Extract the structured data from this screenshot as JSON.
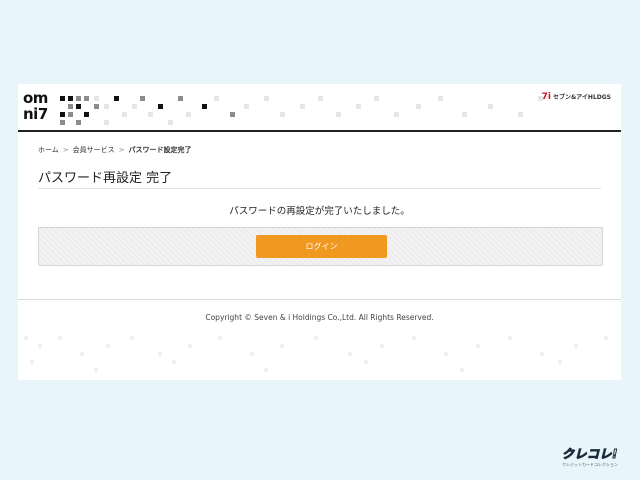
{
  "header": {
    "logo_line1": "om",
    "logo_line2": "ni7",
    "brand_mark": "7i",
    "brand_text": "セブン&アイHLDGS"
  },
  "breadcrumb": {
    "home": "ホーム",
    "member_services": "会員サービス",
    "current": "パスワード設定完了",
    "separator": ">"
  },
  "page": {
    "title": "パスワード再設定 完了",
    "message": "パスワードの再設定が完了いたしました。",
    "login_button": "ログイン"
  },
  "footer": {
    "copyright": "Copyright © Seven & i Holdings Co.,Ltd. All Rights Reserved."
  },
  "watermark": {
    "main": "クレコレ!",
    "sub": "クレジットカードコレクション"
  },
  "colors": {
    "background": "#e8f6fb",
    "button": "#f0981f",
    "header_rule": "#222222"
  }
}
